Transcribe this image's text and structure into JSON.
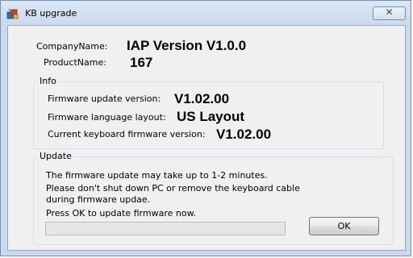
{
  "window": {
    "title": "KB upgrade",
    "close_glyph": "✕"
  },
  "icons": {
    "app": "app-installer-icon",
    "close": "close-icon"
  },
  "info_top": {
    "company_label": "CompanyName:",
    "company_value": "IAP Version V1.0.0",
    "product_label": "ProductName:",
    "product_value": "167"
  },
  "info_group": {
    "title": "Info",
    "rows": [
      {
        "label": "Firmware update version:",
        "value": "V1.02.00"
      },
      {
        "label": "Firmware language layout:",
        "value": "US Layout"
      },
      {
        "label": "Current keyboard firmware version:",
        "value": "V1.02.00"
      }
    ]
  },
  "update_group": {
    "title": "Update",
    "lines": [
      "The firmware update may take up to 1-2 minutes.",
      "Please don't shut down PC or remove the keyboard cable",
      "during firmware updae.",
      "Press OK to update firmware now."
    ],
    "progress": 0,
    "ok_label": "OK"
  },
  "colors": {
    "progress_fill": "#06b025"
  }
}
